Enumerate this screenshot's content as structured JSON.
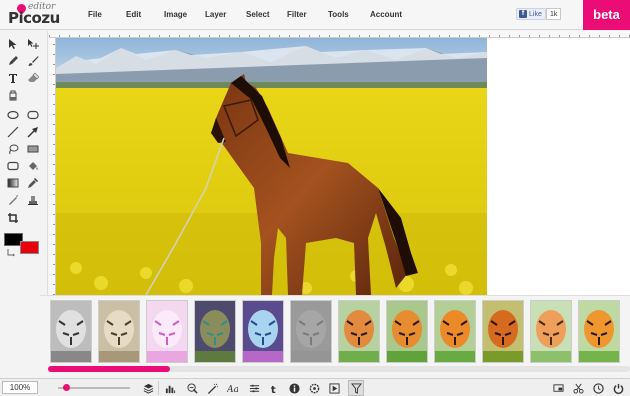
{
  "app": {
    "logo_main": "Picozu",
    "logo_sub": "editor",
    "beta_label": "beta"
  },
  "menu": [
    "File",
    "Edit",
    "Image",
    "Layer",
    "Select",
    "Filter",
    "Tools",
    "Account"
  ],
  "facebook": {
    "like_label": "Like",
    "count": "1k"
  },
  "tools": [
    "pointer-icon",
    "move-icon",
    "pencil-icon",
    "brush-icon",
    "text-icon",
    "eraser-icon",
    "paint-bucket-icon",
    "ellipse-icon",
    "rounded-rect-icon",
    "line-icon",
    "arrow-icon",
    "lasso-icon",
    "rectangle-icon",
    "rounded-rectangle-icon",
    "fill-icon",
    "gradient-icon",
    "eyedropper-icon",
    "smudge-icon",
    "stamp-icon",
    "crop-icon"
  ],
  "colors": {
    "accent": "#ec0c76",
    "foreground": "#000000",
    "background": "#e8000b"
  },
  "filters": [
    "grayscale",
    "sepia",
    "pink-tint",
    "psychedelic",
    "blue-glow",
    "emboss",
    "vintage-1",
    "vintage-2",
    "vintage-3",
    "warm",
    "soft-fade",
    "bright"
  ],
  "filter_scroll": 0.21,
  "zoom": {
    "label": "100%",
    "level": 0.08
  },
  "bottom_tools": [
    "layers-icon",
    "histogram-icon",
    "adjust-icon",
    "effects-icon",
    "font-icon",
    "sliders-icon",
    "twitter-icon",
    "info-icon",
    "settings-icon",
    "play-icon",
    "filter-icon"
  ],
  "bottom_right": [
    "screen-icon",
    "scissors-icon",
    "history-icon",
    "power-icon"
  ]
}
